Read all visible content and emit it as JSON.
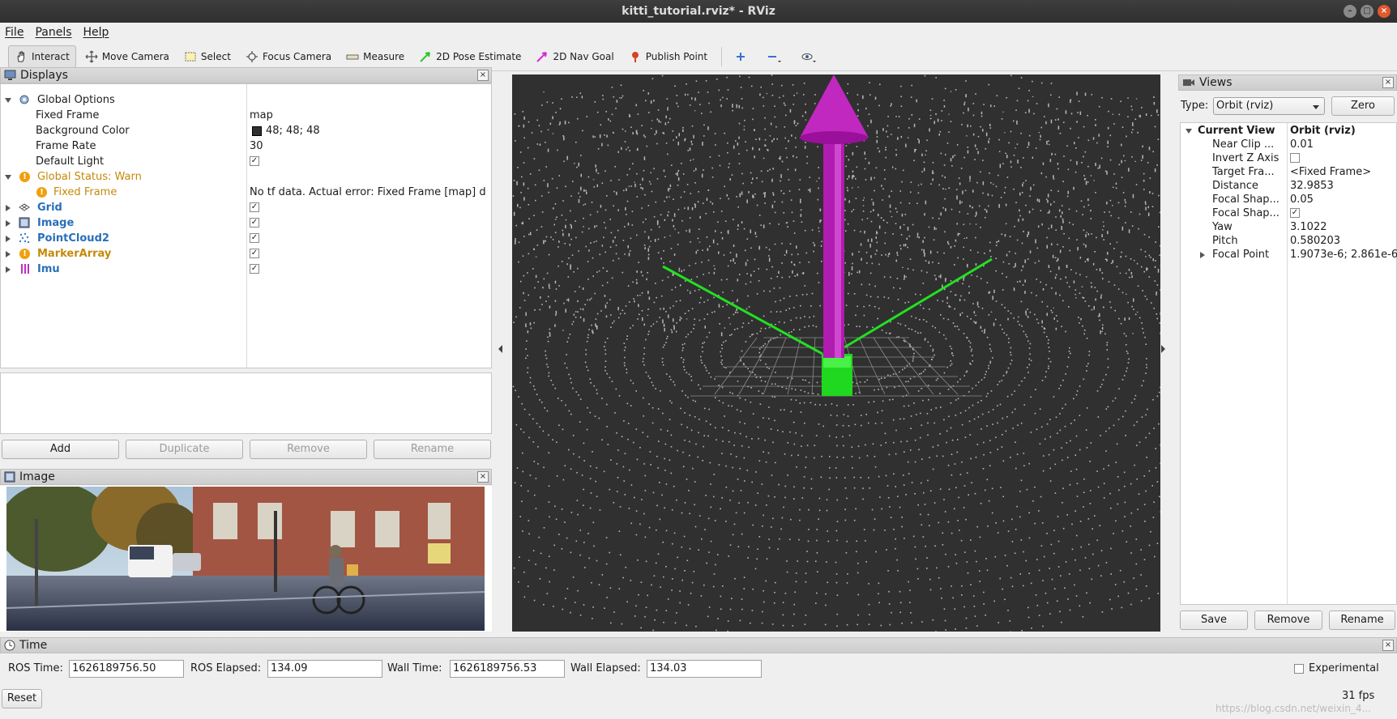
{
  "window": {
    "title": "kitti_tutorial.rviz* - RViz"
  },
  "menu": {
    "items": [
      "File",
      "Panels",
      "Help"
    ]
  },
  "toolbar": {
    "tools": [
      {
        "label": "Interact",
        "icon": "hand-icon",
        "active": true
      },
      {
        "label": "Move Camera",
        "icon": "move-camera-icon"
      },
      {
        "label": "Select",
        "icon": "select-icon"
      },
      {
        "label": "Focus Camera",
        "icon": "focus-camera-icon"
      },
      {
        "label": "Measure",
        "icon": "ruler-icon"
      },
      {
        "label": "2D Pose Estimate",
        "icon": "pose-arrow-icon"
      },
      {
        "label": "2D Nav Goal",
        "icon": "nav-goal-icon"
      },
      {
        "label": "Publish Point",
        "icon": "pin-icon"
      }
    ]
  },
  "displays": {
    "title": "Displays",
    "global_options": {
      "label": "Global Options",
      "fixed_frame_label": "Fixed Frame",
      "fixed_frame_value": "map",
      "bg_color_label": "Background Color",
      "bg_color_value": "48; 48; 48",
      "bg_color_hex": "#303030",
      "frame_rate_label": "Frame Rate",
      "frame_rate_value": "30",
      "default_light_label": "Default Light"
    },
    "global_status": {
      "label": "Global Status: Warn",
      "fixed_frame_label": "Fixed Frame",
      "fixed_frame_value": "No tf data.  Actual error: Fixed Frame [map] d"
    },
    "items": [
      {
        "label": "Grid",
        "warn": false
      },
      {
        "label": "Image",
        "warn": false
      },
      {
        "label": "PointCloud2",
        "warn": false
      },
      {
        "label": "MarkerArray",
        "warn": true
      },
      {
        "label": "Imu",
        "warn": false
      }
    ],
    "buttons": {
      "add": "Add",
      "duplicate": "Duplicate",
      "remove": "Remove",
      "rename": "Rename"
    }
  },
  "image_panel": {
    "title": "Image"
  },
  "views": {
    "title": "Views",
    "type_label": "Type:",
    "type_value": "Orbit (rviz)",
    "zero_label": "Zero",
    "current_view_label": "Current View",
    "current_view_value": "Orbit (rviz)",
    "props": [
      {
        "name": "Near Clip ...",
        "value": "0.01"
      },
      {
        "name": "Invert Z Axis",
        "value": "",
        "check": "unchecked"
      },
      {
        "name": "Target Fra...",
        "value": "<Fixed Frame>"
      },
      {
        "name": "Distance",
        "value": "32.9853"
      },
      {
        "name": "Focal Shap...",
        "value": "0.05"
      },
      {
        "name": "Focal Shap...",
        "value": "",
        "check": "checked"
      },
      {
        "name": "Yaw",
        "value": "3.1022"
      },
      {
        "name": "Pitch",
        "value": "0.580203"
      },
      {
        "name": "Focal Point",
        "value": "1.9073e-6; 2.861e-6"
      }
    ],
    "buttons": {
      "save": "Save",
      "remove": "Remove",
      "rename": "Rename"
    }
  },
  "time": {
    "title": "Time",
    "ros_time_label": "ROS Time:",
    "ros_time_value": "1626189756.50",
    "ros_elapsed_label": "ROS Elapsed:",
    "ros_elapsed_value": "134.09",
    "wall_time_label": "Wall Time:",
    "wall_time_value": "1626189756.53",
    "wall_elapsed_label": "Wall Elapsed:",
    "wall_elapsed_value": "134.03",
    "experimental_label": "Experimental",
    "reset_label": "Reset",
    "fps": "31 fps"
  },
  "watermark": "https://blog.csdn.net/weixin_4..."
}
